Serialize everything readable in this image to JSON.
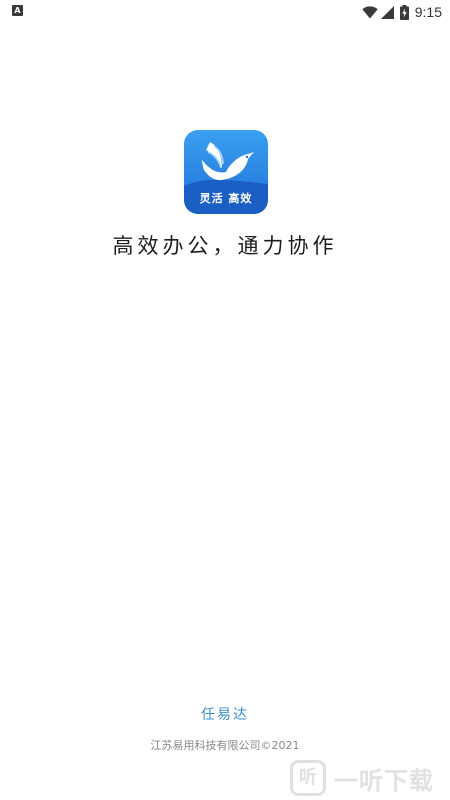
{
  "status_bar": {
    "notification_icon_label": "A",
    "time": "9:15",
    "icons": [
      "notification-icon",
      "wifi-icon",
      "signal-icon",
      "battery-icon"
    ]
  },
  "logo": {
    "icon": "dove-icon",
    "caption": "灵活 高效",
    "colors": {
      "gradient_top": "#3aa0ef",
      "gradient_bottom": "#1f6fd8",
      "wave": "#1b5fc4"
    }
  },
  "tagline": "高效办公，通力协作",
  "footer": {
    "brand": "任易达",
    "copyright": "江苏易用科技有限公司©2021",
    "brand_color": "#3c8fc9"
  },
  "watermark": {
    "icon_glyph": "听",
    "text": "一听下载"
  }
}
